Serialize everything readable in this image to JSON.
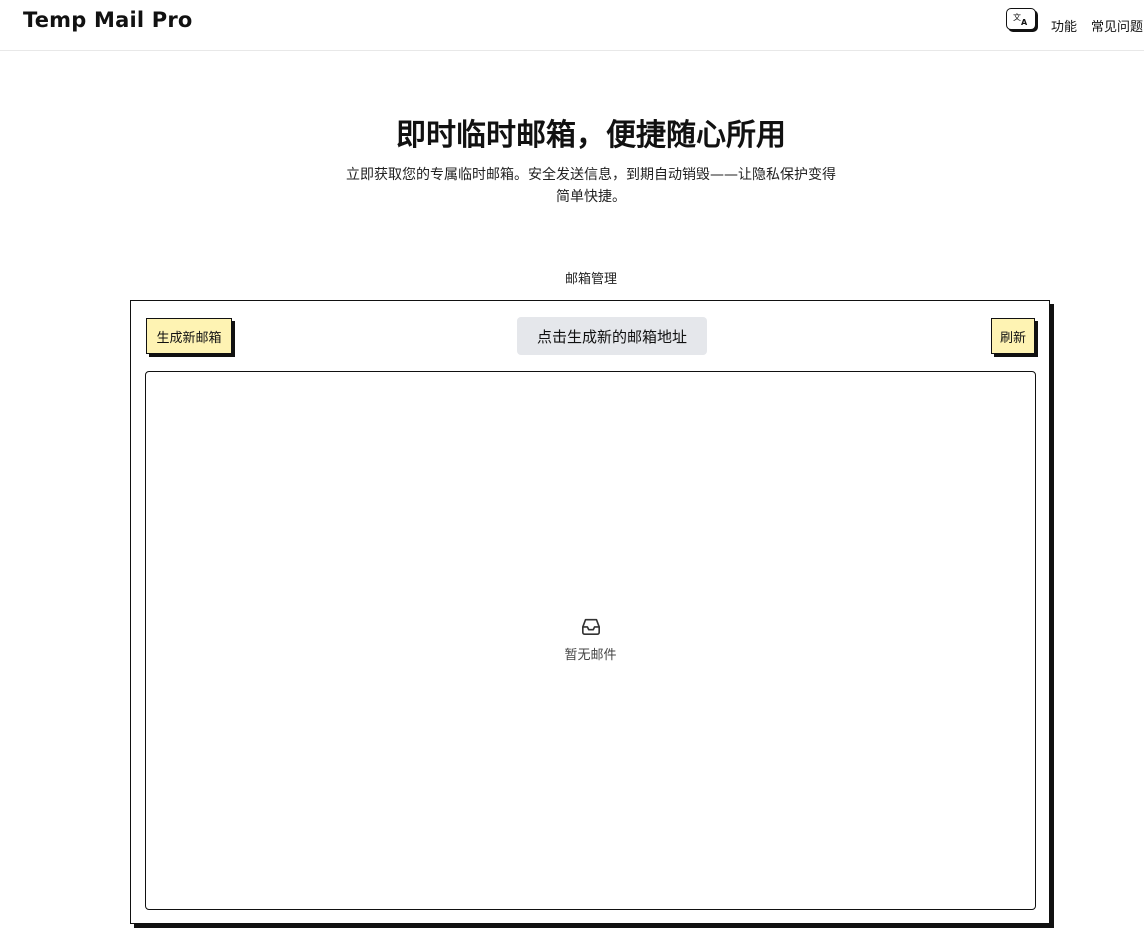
{
  "header": {
    "brand": "Temp Mail Pro",
    "lang_icon": "translate-icon",
    "nav": [
      "功能",
      "常见问题"
    ]
  },
  "hero": {
    "title": "即时临时邮箱，便捷随心所用",
    "subtitle_line1": "立即获取您的专属临时邮箱。安全发送信息，到期自动销毁——让隐私保护变得",
    "subtitle_line2": "简单快捷。"
  },
  "mailbox": {
    "section_label": "邮箱管理",
    "generate_label": "生成新邮箱",
    "address_placeholder": "点击生成新的邮箱地址",
    "refresh_label": "刷新",
    "empty_icon": "inbox-icon",
    "empty_text": "暂无邮件"
  },
  "colors": {
    "button_yellow": "#fef3b3",
    "address_bg": "#e5e7eb",
    "border": "#111111"
  }
}
